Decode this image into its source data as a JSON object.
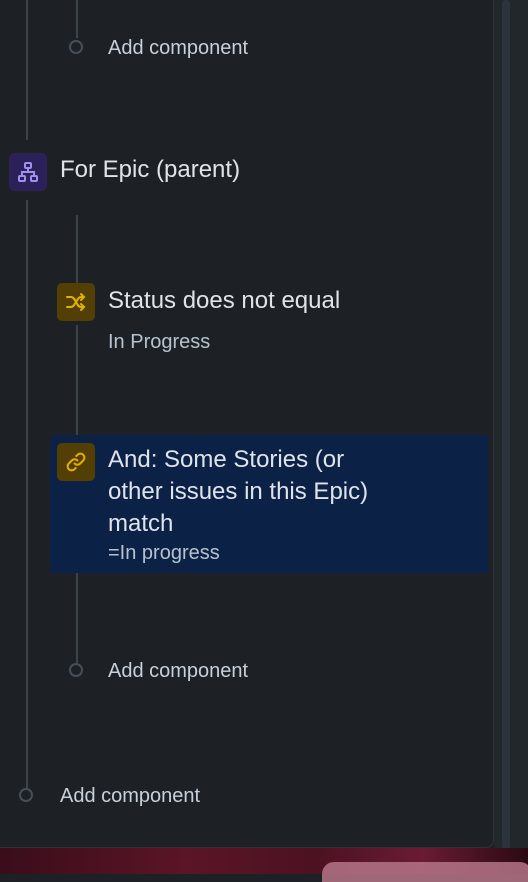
{
  "rule": {
    "top_add": {
      "label": "Add component"
    },
    "branch": {
      "label": "For Epic (parent)",
      "icon": "hierarchy-icon",
      "icon_color": "#9f8fef",
      "icon_bg": "#2b2158"
    },
    "condition": {
      "title": "Status does not equal",
      "value": "In Progress",
      "icon": "shuffle-icon",
      "icon_color": "#e2b203",
      "icon_bg": "#533f04"
    },
    "and_condition": {
      "title_line1": "And: Some Stories (or",
      "title_line2": "other issues in this Epic)",
      "title_line3": "match",
      "value": "=In progress",
      "icon": "link-icon",
      "icon_color": "#e2b203",
      "icon_bg": "#533f04"
    },
    "inner_add": {
      "label": "Add component"
    },
    "outer_add": {
      "label": "Add component"
    }
  },
  "colors": {
    "background": "#1d2125",
    "selected": "#0c2146",
    "connector": "#3b434b"
  }
}
